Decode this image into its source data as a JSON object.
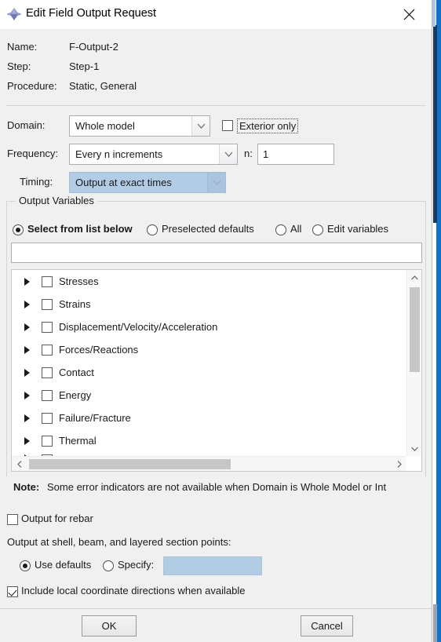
{
  "window": {
    "title": "Edit Field Output Request",
    "icon": "abaqus-diamond-icon",
    "close_icon": "close-icon"
  },
  "header": {
    "rows": [
      {
        "label": "Name:",
        "value": "F-Output-2"
      },
      {
        "label": "Step:",
        "value": "Step-1"
      },
      {
        "label": "Procedure:",
        "value": "Static, General"
      }
    ]
  },
  "domain": {
    "label": "Domain:",
    "value": "Whole model",
    "exterior_only": {
      "label": "Exterior only",
      "checked": false,
      "focused": true
    }
  },
  "frequency": {
    "label": "Frequency:",
    "value": "Every n increments",
    "n_label": "n:",
    "n_value": "1"
  },
  "timing": {
    "label": "Timing:",
    "value": "Output at exact times",
    "disabled": true
  },
  "output_variables": {
    "group_title": "Output Variables",
    "radios": [
      {
        "label": "Select from list below",
        "selected": true
      },
      {
        "label": "Preselected defaults",
        "selected": false
      },
      {
        "label": "All",
        "selected": false
      },
      {
        "label": "Edit variables",
        "selected": false
      }
    ],
    "filter_value": "",
    "tree_items": [
      {
        "label": "Stresses",
        "checked": false,
        "expanded": false
      },
      {
        "label": "Strains",
        "checked": false,
        "expanded": false
      },
      {
        "label": "Displacement/Velocity/Acceleration",
        "checked": false,
        "expanded": false
      },
      {
        "label": "Forces/Reactions",
        "checked": false,
        "expanded": false
      },
      {
        "label": "Contact",
        "checked": false,
        "expanded": false
      },
      {
        "label": "Energy",
        "checked": false,
        "expanded": false
      },
      {
        "label": "Failure/Fracture",
        "checked": false,
        "expanded": false
      },
      {
        "label": "Thermal",
        "checked": false,
        "expanded": false
      }
    ],
    "note_strong": "Note:",
    "note_text": "Some error indicators are not available when Domain is Whole Model or Int"
  },
  "bottom": {
    "output_for_rebar": {
      "label": "Output for rebar",
      "checked": false
    },
    "section_points_label": "Output at shell, beam, and layered section points:",
    "use_defaults": {
      "label": "Use defaults",
      "selected": true
    },
    "specify": {
      "label": "Specify:",
      "selected": false,
      "value": "",
      "disabled": true
    },
    "include_local": {
      "label": "Include local coordinate directions when available",
      "checked": true
    }
  },
  "footer": {
    "ok_label": "OK",
    "cancel_label": "Cancel"
  },
  "colors": {
    "dialog_background": "#f0f0f0",
    "disabled_field": "#b3cce5",
    "accent_blue": "#1272c8",
    "scrollbar_thumb": "#c6c6c6"
  }
}
